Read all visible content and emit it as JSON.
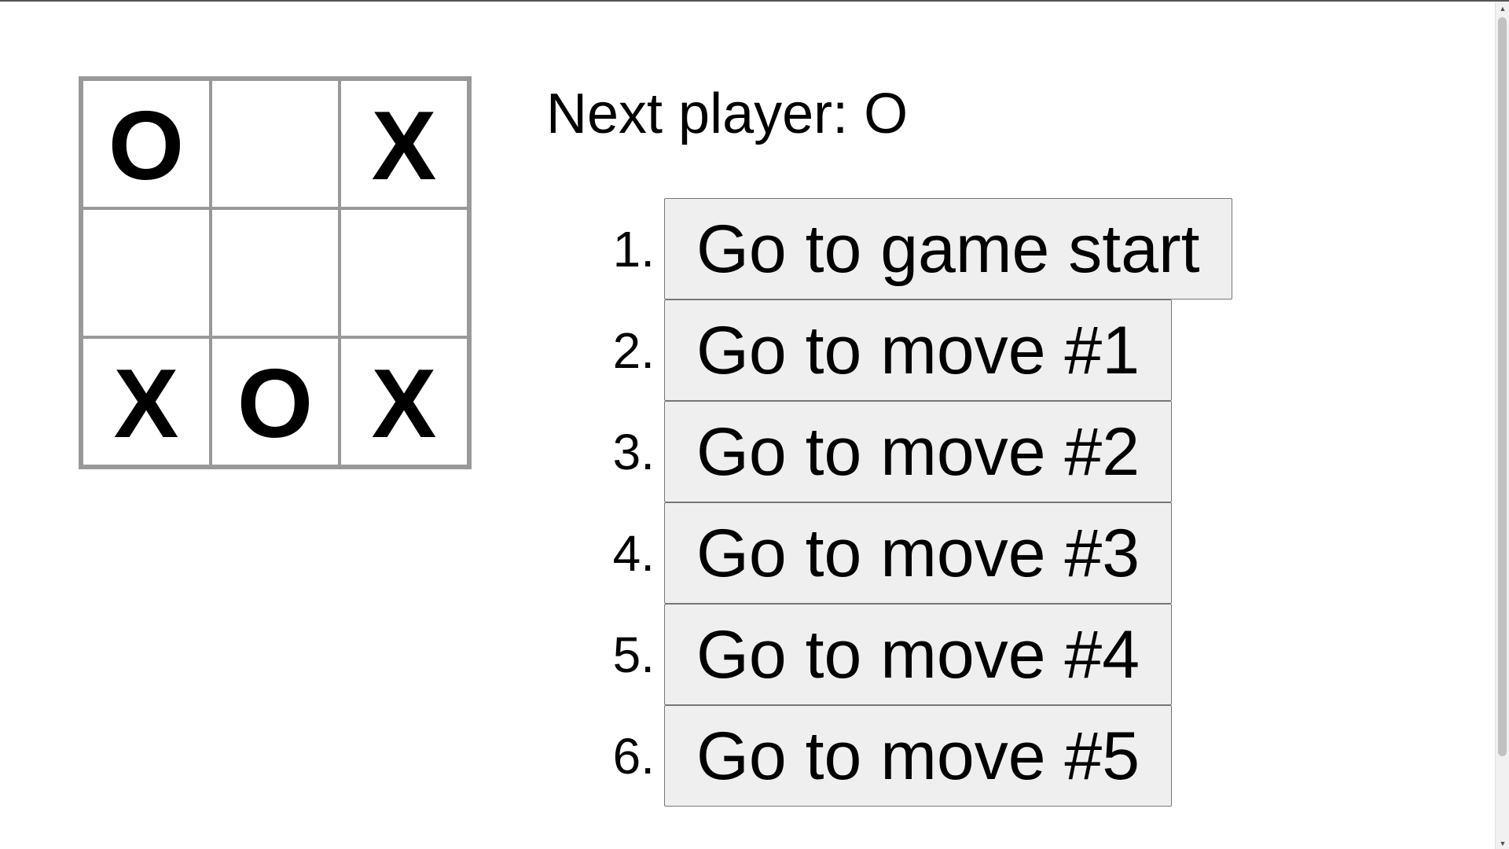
{
  "board": {
    "squares": [
      "O",
      "",
      "X",
      "",
      "",
      "",
      "X",
      "O",
      "X"
    ]
  },
  "status": {
    "text": "Next player: O"
  },
  "moves": [
    {
      "number": "1.",
      "label": "Go to game start"
    },
    {
      "number": "2.",
      "label": "Go to move #1"
    },
    {
      "number": "3.",
      "label": "Go to move #2"
    },
    {
      "number": "4.",
      "label": "Go to move #3"
    },
    {
      "number": "5.",
      "label": "Go to move #4"
    },
    {
      "number": "6.",
      "label": "Go to move #5"
    }
  ],
  "scrollbar": {
    "up_icon": "scroll-up-arrow-icon",
    "down_icon": "scroll-down-arrow-icon"
  }
}
